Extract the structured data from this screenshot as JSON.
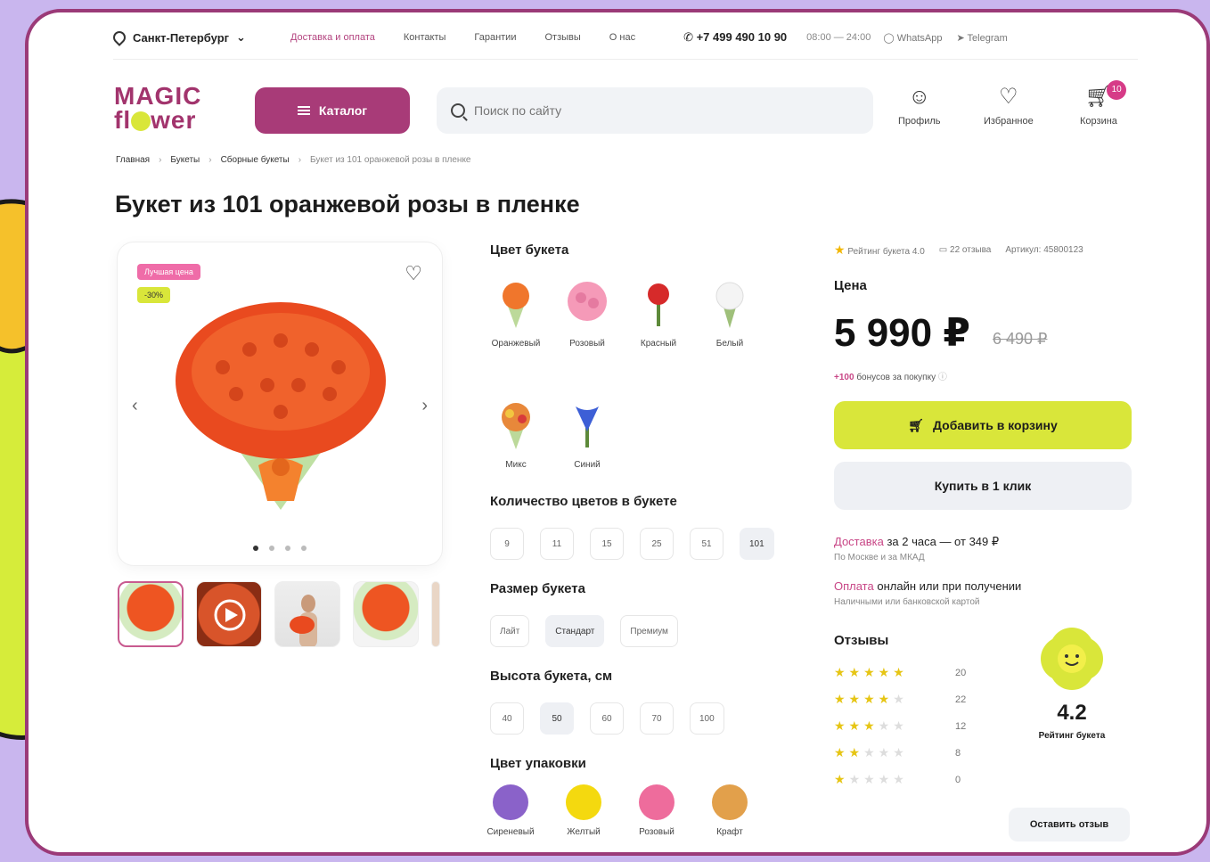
{
  "topbar": {
    "city": "Санкт-Петербург",
    "nav": [
      "Доставка и оплата",
      "Контакты",
      "Гарантии",
      "Отзывы",
      "О нас"
    ],
    "phone": "+7 499 490 10 90",
    "hours": "08:00 — 24:00",
    "whatsapp": "WhatsApp",
    "telegram": "Telegram"
  },
  "header": {
    "logo_line1": "MAGIC",
    "logo_line2a": "fl",
    "logo_line2b": "wer",
    "catalog_label": "Каталог",
    "search_placeholder": "Поиск по сайту",
    "profile_label": "Профиль",
    "favorites_label": "Избранное",
    "cart_label": "Корзина",
    "cart_count": "10"
  },
  "breadcrumbs": [
    "Главная",
    "Букеты",
    "Сборные букеты",
    "Букет из 101 оранжевой розы в пленке"
  ],
  "product": {
    "title": "Букет из 101 оранжевой розы в пленке",
    "tag_hit": "Лучшая цена",
    "tag_sale": "-30%",
    "rating_text": "Рейтинг букета 4.0",
    "reviews_text": "22 отзыва",
    "article_text": "Артикул: 45800123",
    "price_label": "Цена",
    "price": "5 990 ₽",
    "old_price": "6 490 ₽",
    "bonus_prefix": "+",
    "bonus_value": "100",
    "bonus_suffix": "бонусов за покупку",
    "add_to_cart": "Добавить в корзину",
    "buy_one_click": "Купить в 1 клик",
    "delivery_link": "Доставка",
    "delivery_text": "за 2 часа — от 349 ₽",
    "delivery_sub": "По Москве и за МКАД",
    "payment_link": "Оплата",
    "payment_text": "онлайн или при получении",
    "payment_sub": "Наличными или банковской картой"
  },
  "options": {
    "color_title": "Цвет букета",
    "colors": [
      {
        "label": "Оранжевый",
        "color": "#f0762c"
      },
      {
        "label": "Розовый",
        "color": "#f59ab8"
      },
      {
        "label": "Красный",
        "color": "#d62a2a"
      },
      {
        "label": "Белый",
        "color": "#f2f2f2"
      },
      {
        "label": "Микс",
        "color": "#e8883a"
      },
      {
        "label": "Синий",
        "color": "#3d5fd6"
      }
    ],
    "count_title": "Количество цветов в букете",
    "counts": [
      "9",
      "11",
      "15",
      "25",
      "51",
      "101"
    ],
    "count_selected": "101",
    "size_title": "Размер букета",
    "sizes": [
      "Лайт",
      "Стандарт",
      "Премиум"
    ],
    "size_selected": "Стандарт",
    "height_title": "Высота букета, см",
    "heights": [
      "40",
      "50",
      "60",
      "70",
      "100"
    ],
    "height_selected": "50",
    "wrap_title": "Цвет упаковки",
    "wraps": [
      {
        "label": "Сиреневый",
        "color": "#8a62c9"
      },
      {
        "label": "Желтый",
        "color": "#f4d90f"
      },
      {
        "label": "Розовый",
        "color": "#ee6c9c"
      },
      {
        "label": "Крафт",
        "color": "#e2a04b"
      }
    ]
  },
  "reviews": {
    "title": "Отзывы",
    "rows": [
      {
        "stars": 5,
        "count": "20"
      },
      {
        "stars": 4,
        "count": "22"
      },
      {
        "stars": 3,
        "count": "12"
      },
      {
        "stars": 2,
        "count": "8"
      },
      {
        "stars": 1,
        "count": "0"
      }
    ],
    "rating": "4.2",
    "rating_label": "Рейтинг букета",
    "leave_review": "Оставить отзыв"
  },
  "gallery": {
    "active_slide": 1,
    "slides": 4
  }
}
